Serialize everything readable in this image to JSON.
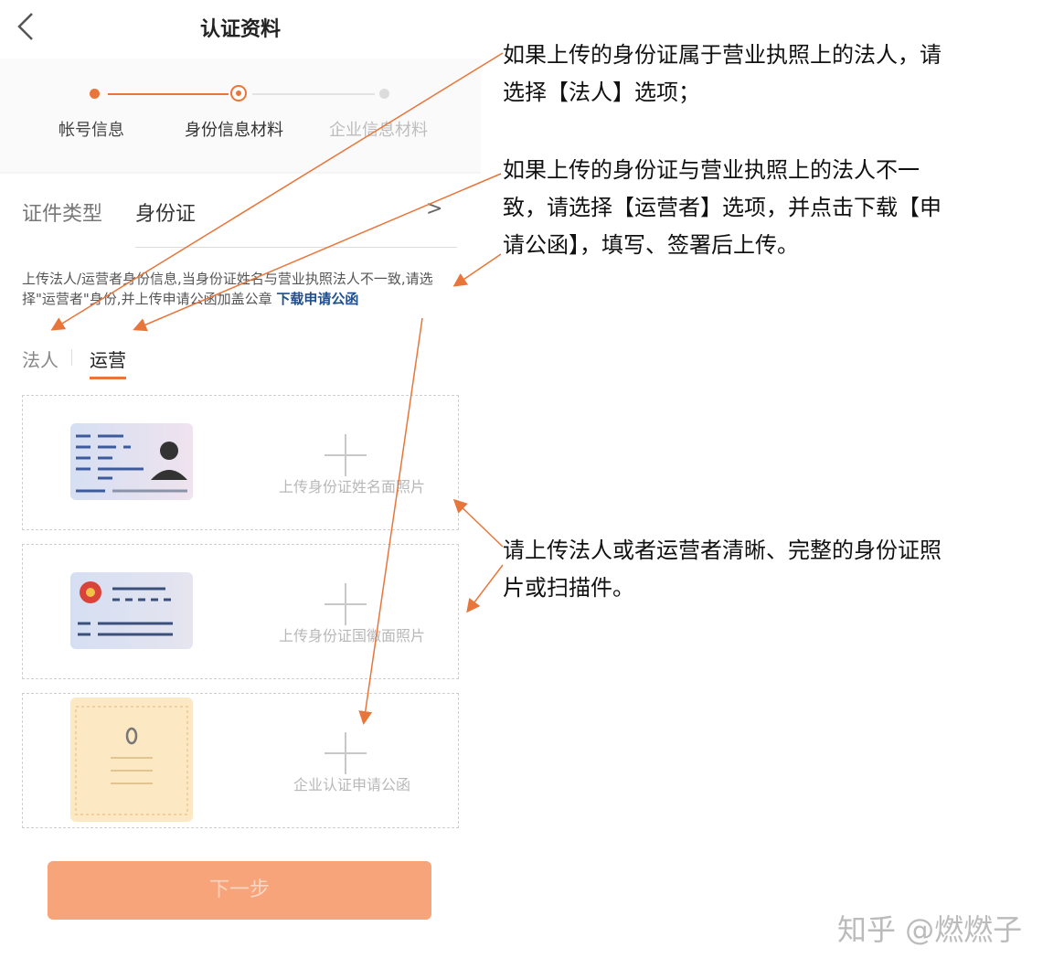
{
  "header": {
    "title": "认证资料",
    "back_icon": "chevron-left-icon"
  },
  "steps": [
    {
      "label": "帐号信息",
      "state": "done"
    },
    {
      "label": "身份信息材料",
      "state": "current"
    },
    {
      "label": "企业信息材料",
      "state": "todo"
    }
  ],
  "form": {
    "id_type_label": "证件类型",
    "id_type_value": "身份证",
    "chevron": ">",
    "hint": "上传法人/运营者身份信息,当身份证姓名与营业执照法人不一致,请选择\"运营者\"身份,并上传申请公函加盖公章",
    "hint_link": "下载申请公函",
    "tabs": [
      "法人",
      "运营"
    ],
    "selected_tab": "运营"
  },
  "uploads": [
    {
      "label": "上传身份证姓名面照片"
    },
    {
      "label": "上传身份证国徽面照片"
    },
    {
      "label": "企业认证申请公函"
    }
  ],
  "next_button": "下一步",
  "annotations": [
    "如果上传的身份证属于营业执照上的法人，请选择【法人】选项；",
    "如果上传的身份证与营业执照上的法人不一致，请选择【运营者】选项，并点击下载【申请公函】，填写、签署后上传。",
    "请上传法人或者运营者清晰、完整的身份证照片或扫描件。"
  ],
  "annotation_lines": [
    [
      "如果上传的身份证属于营业执照上的法人，请",
      "选择【法人】选项；"
    ],
    [
      "如果上传的身份证与营业执照上的法人不一",
      "致，请选择【运营者】选项，并点击下载【申",
      "请公函】，填写、签署后上传。"
    ],
    [
      "请上传法人或者运营者清晰、完整的身份证照",
      "片或扫描件。"
    ]
  ],
  "watermark": "知乎 @燃燃子",
  "colors": {
    "accent": "#e8763a",
    "button": "#f7a47b",
    "link": "#1f4f8f"
  }
}
